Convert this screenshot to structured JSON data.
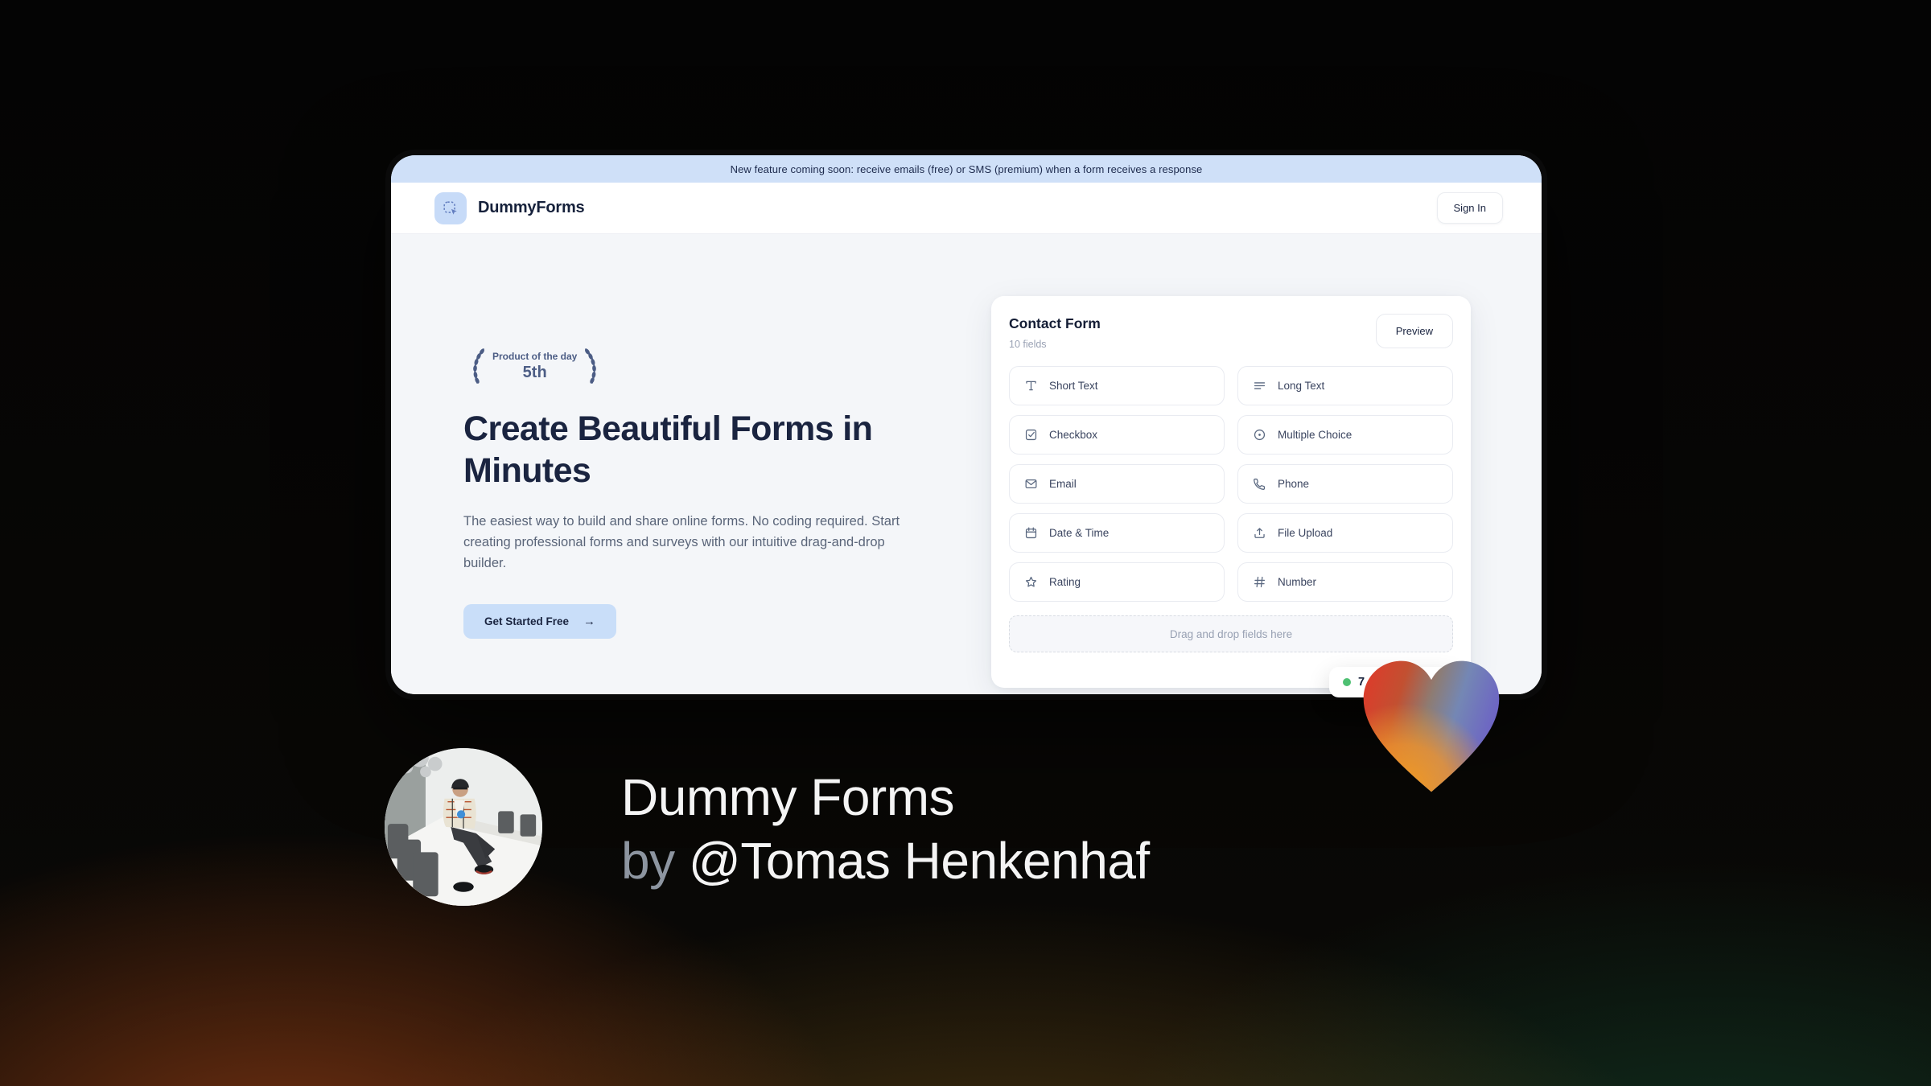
{
  "window": {
    "banner": {
      "text": "New feature coming soon: receive emails (free) or SMS (premium) when a form receives a response"
    },
    "header": {
      "brand": "DummyForms",
      "logo_icon": "dashed-select-cursor-icon",
      "sign_in_label": "Sign In"
    },
    "hero": {
      "badge": {
        "line1": "Product of the day",
        "line2": "5th",
        "icon": "laurel-wreath-icon"
      },
      "headline": "Create Beautiful Forms in Minutes",
      "description": "The easiest way to build and share online forms. No coding required. Start creating professional forms and surveys with our intuitive drag-and-drop builder.",
      "cta_label": "Get Started Free",
      "cta_icon": "arrow-right-icon",
      "cta_arrow": "→"
    },
    "form_builder": {
      "title": "Contact Form",
      "subtitle": "10 fields",
      "preview_button": "Preview",
      "fields": [
        {
          "label": "Short Text",
          "icon": "short-text-icon"
        },
        {
          "label": "Long Text",
          "icon": "long-text-icon"
        },
        {
          "label": "Checkbox",
          "icon": "checkbox-icon"
        },
        {
          "label": "Multiple Choice",
          "icon": "radio-icon"
        },
        {
          "label": "Email",
          "icon": "envelope-icon"
        },
        {
          "label": "Phone",
          "icon": "phone-icon"
        },
        {
          "label": "Date & Time",
          "icon": "calendar-icon"
        },
        {
          "label": "File Upload",
          "icon": "upload-icon"
        },
        {
          "label": "Rating",
          "icon": "star-icon"
        },
        {
          "label": "Number",
          "icon": "hash-icon"
        }
      ],
      "dropzone_text": "Drag and drop fields here",
      "upvote_badge": {
        "count": "7",
        "dot_color": "#4ec072"
      }
    }
  },
  "footer": {
    "title": "Dummy Forms",
    "byline_prefix": "by",
    "author": "@Tomas Henkenhaf",
    "heart_icon": "gradient-heart-icon",
    "avatar": "author-photo"
  },
  "colors": {
    "banner_blue": "#cfe0f8",
    "accent_blue": "#c9def9",
    "navy": "#1a2440",
    "muted_text": "#5a6579",
    "hero_bg": "#f4f6f9",
    "green_dot": "#4ec072",
    "heart_red": "#e0392a",
    "heart_orange": "#f49b1f",
    "heart_steel_blue": "#7487b4",
    "heart_purple": "#6d64c4"
  }
}
